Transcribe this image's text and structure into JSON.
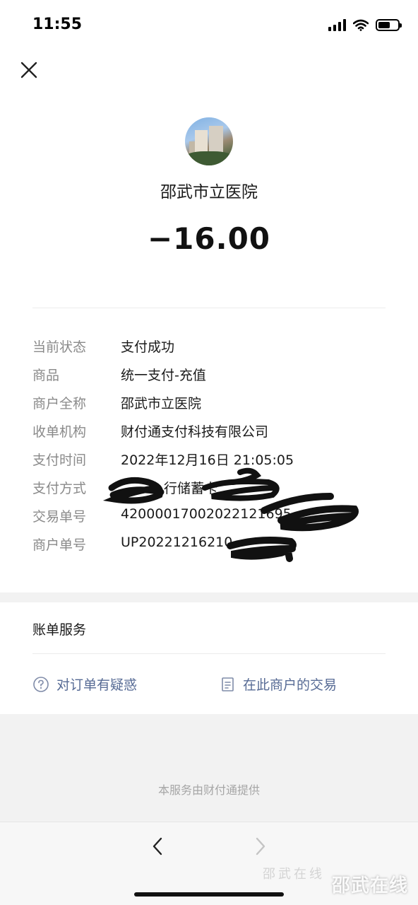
{
  "status_bar": {
    "time": "11:55"
  },
  "header": {
    "merchant_name": "邵武市立医院",
    "amount": "−16.00"
  },
  "details": [
    {
      "label": "当前状态",
      "value": "支付成功"
    },
    {
      "label": "商品",
      "value": "统一支付-充值"
    },
    {
      "label": "商户全称",
      "value": "邵武市立医院"
    },
    {
      "label": "收单机构",
      "value": "财付通支付科技有限公司"
    },
    {
      "label": "支付时间",
      "value": "2022年12月16日 21:05:05"
    },
    {
      "label": "支付方式",
      "value": "行储蓄卡"
    },
    {
      "label": "交易单号",
      "value": "42000017002022121695"
    },
    {
      "label": "商户单号",
      "value": "UP20221216210"
    }
  ],
  "bill_services": {
    "title": "账单服务",
    "query_link": "对订单有疑惑",
    "merchant_link": "在此商户的交易"
  },
  "footer": {
    "provider": "本服务由财付通提供"
  },
  "watermark": {
    "text": "邵武在线",
    "faint_text": "邵武在线"
  },
  "icons": {
    "close": "close-icon",
    "question": "question-circle-icon",
    "document": "document-list-icon",
    "back": "chevron-left-icon",
    "forward": "chevron-right-icon",
    "wifi": "wifi-icon",
    "signal": "signal-icon",
    "battery": "battery-icon"
  },
  "colors": {
    "link": "#576b95",
    "label": "#8a8a8a",
    "text": "#1a1a1a",
    "gray_band": "#f2f2f2"
  }
}
